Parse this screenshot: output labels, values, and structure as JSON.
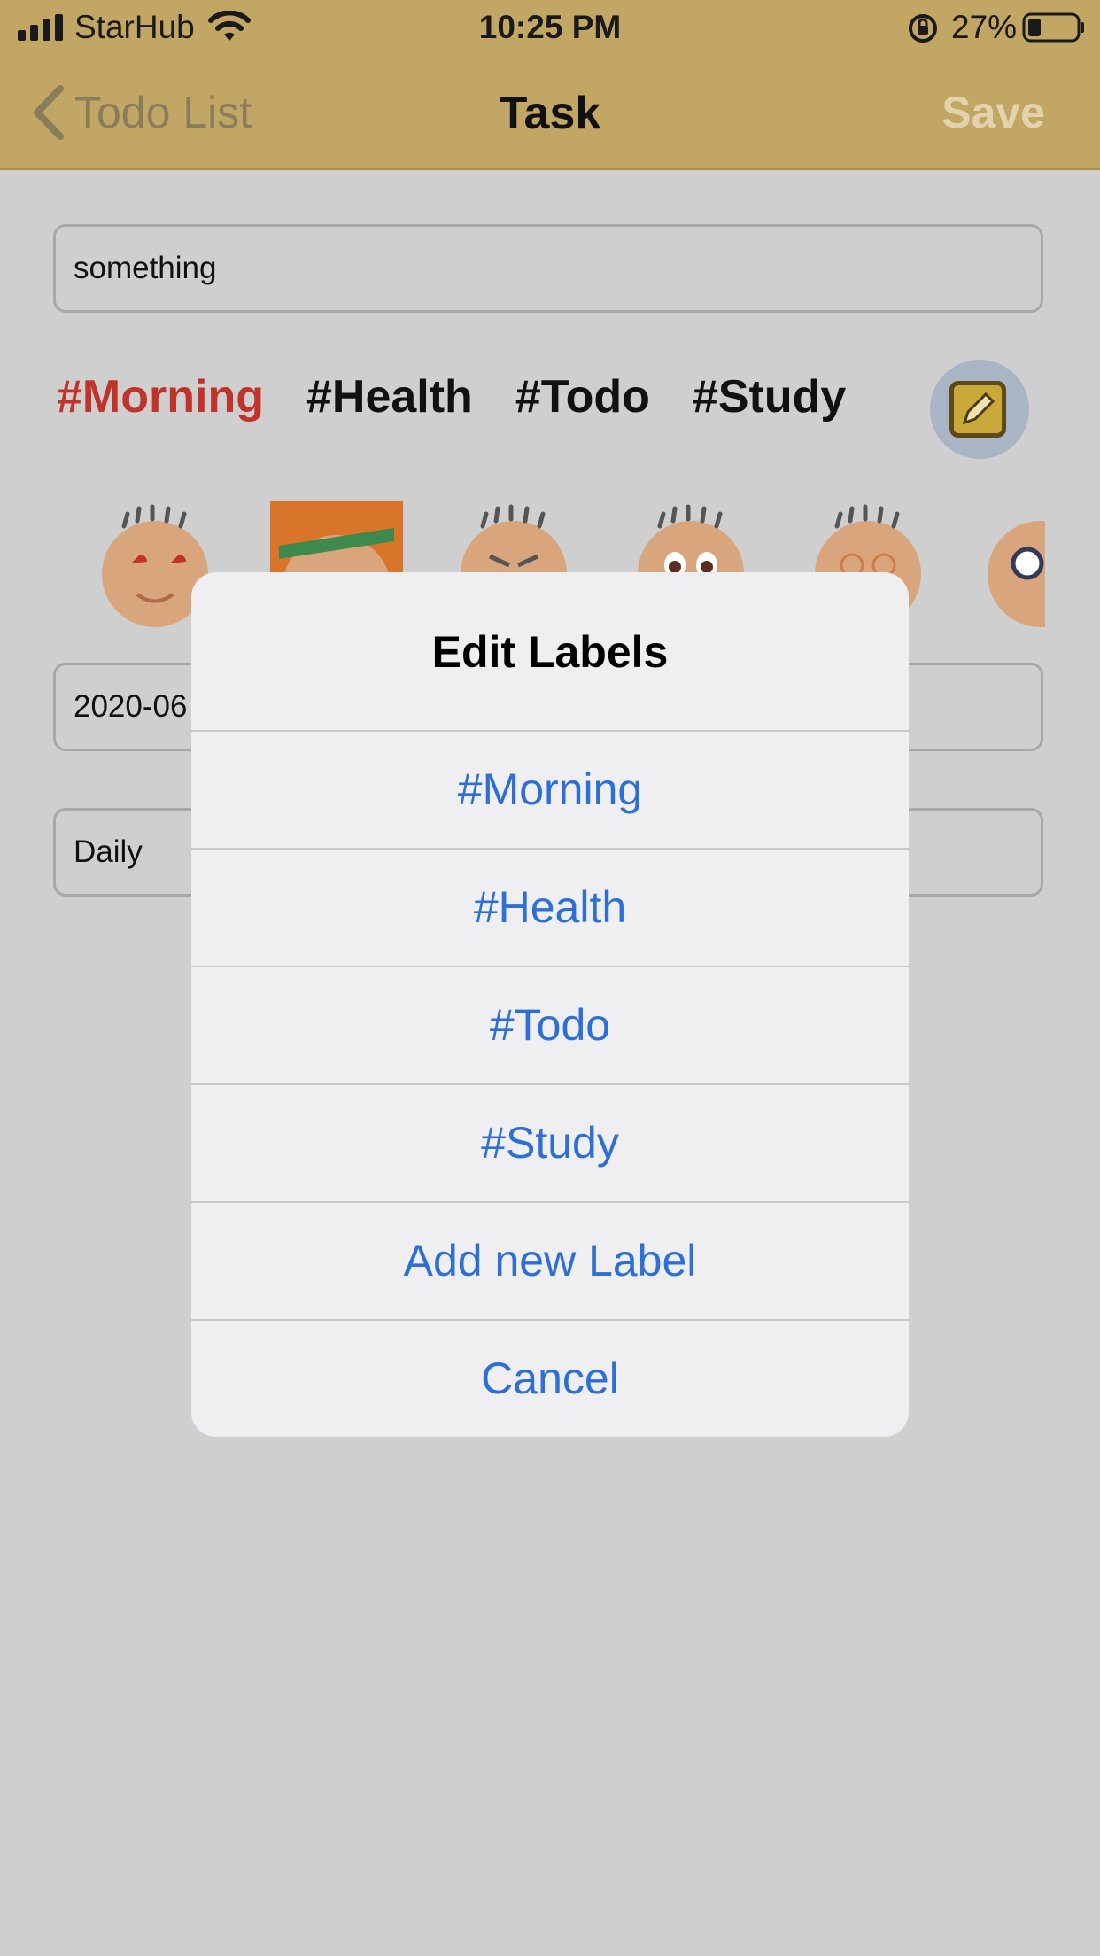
{
  "status_bar": {
    "carrier": "StarHub",
    "time": "10:25 PM",
    "battery": "27%"
  },
  "nav": {
    "back_label": "Todo List",
    "title": "Task",
    "save_label": "Save"
  },
  "form": {
    "task_value": "something",
    "date_value": "2020-06",
    "repeat_value": "Daily"
  },
  "labels": [
    "#Morning",
    "#Health",
    "#Todo",
    "#Study"
  ],
  "active_label_color": "#c0332a",
  "accent_color": "#c2a764",
  "dialog": {
    "title": "Edit Labels",
    "options": [
      "#Morning",
      "#Health",
      "#Todo",
      "#Study",
      "Add new Label",
      "Cancel"
    ]
  },
  "icons": [
    "signal-icon",
    "wifi-icon",
    "rotation-lock-icon",
    "battery-icon",
    "chevron-left-icon",
    "pencil-icon"
  ]
}
